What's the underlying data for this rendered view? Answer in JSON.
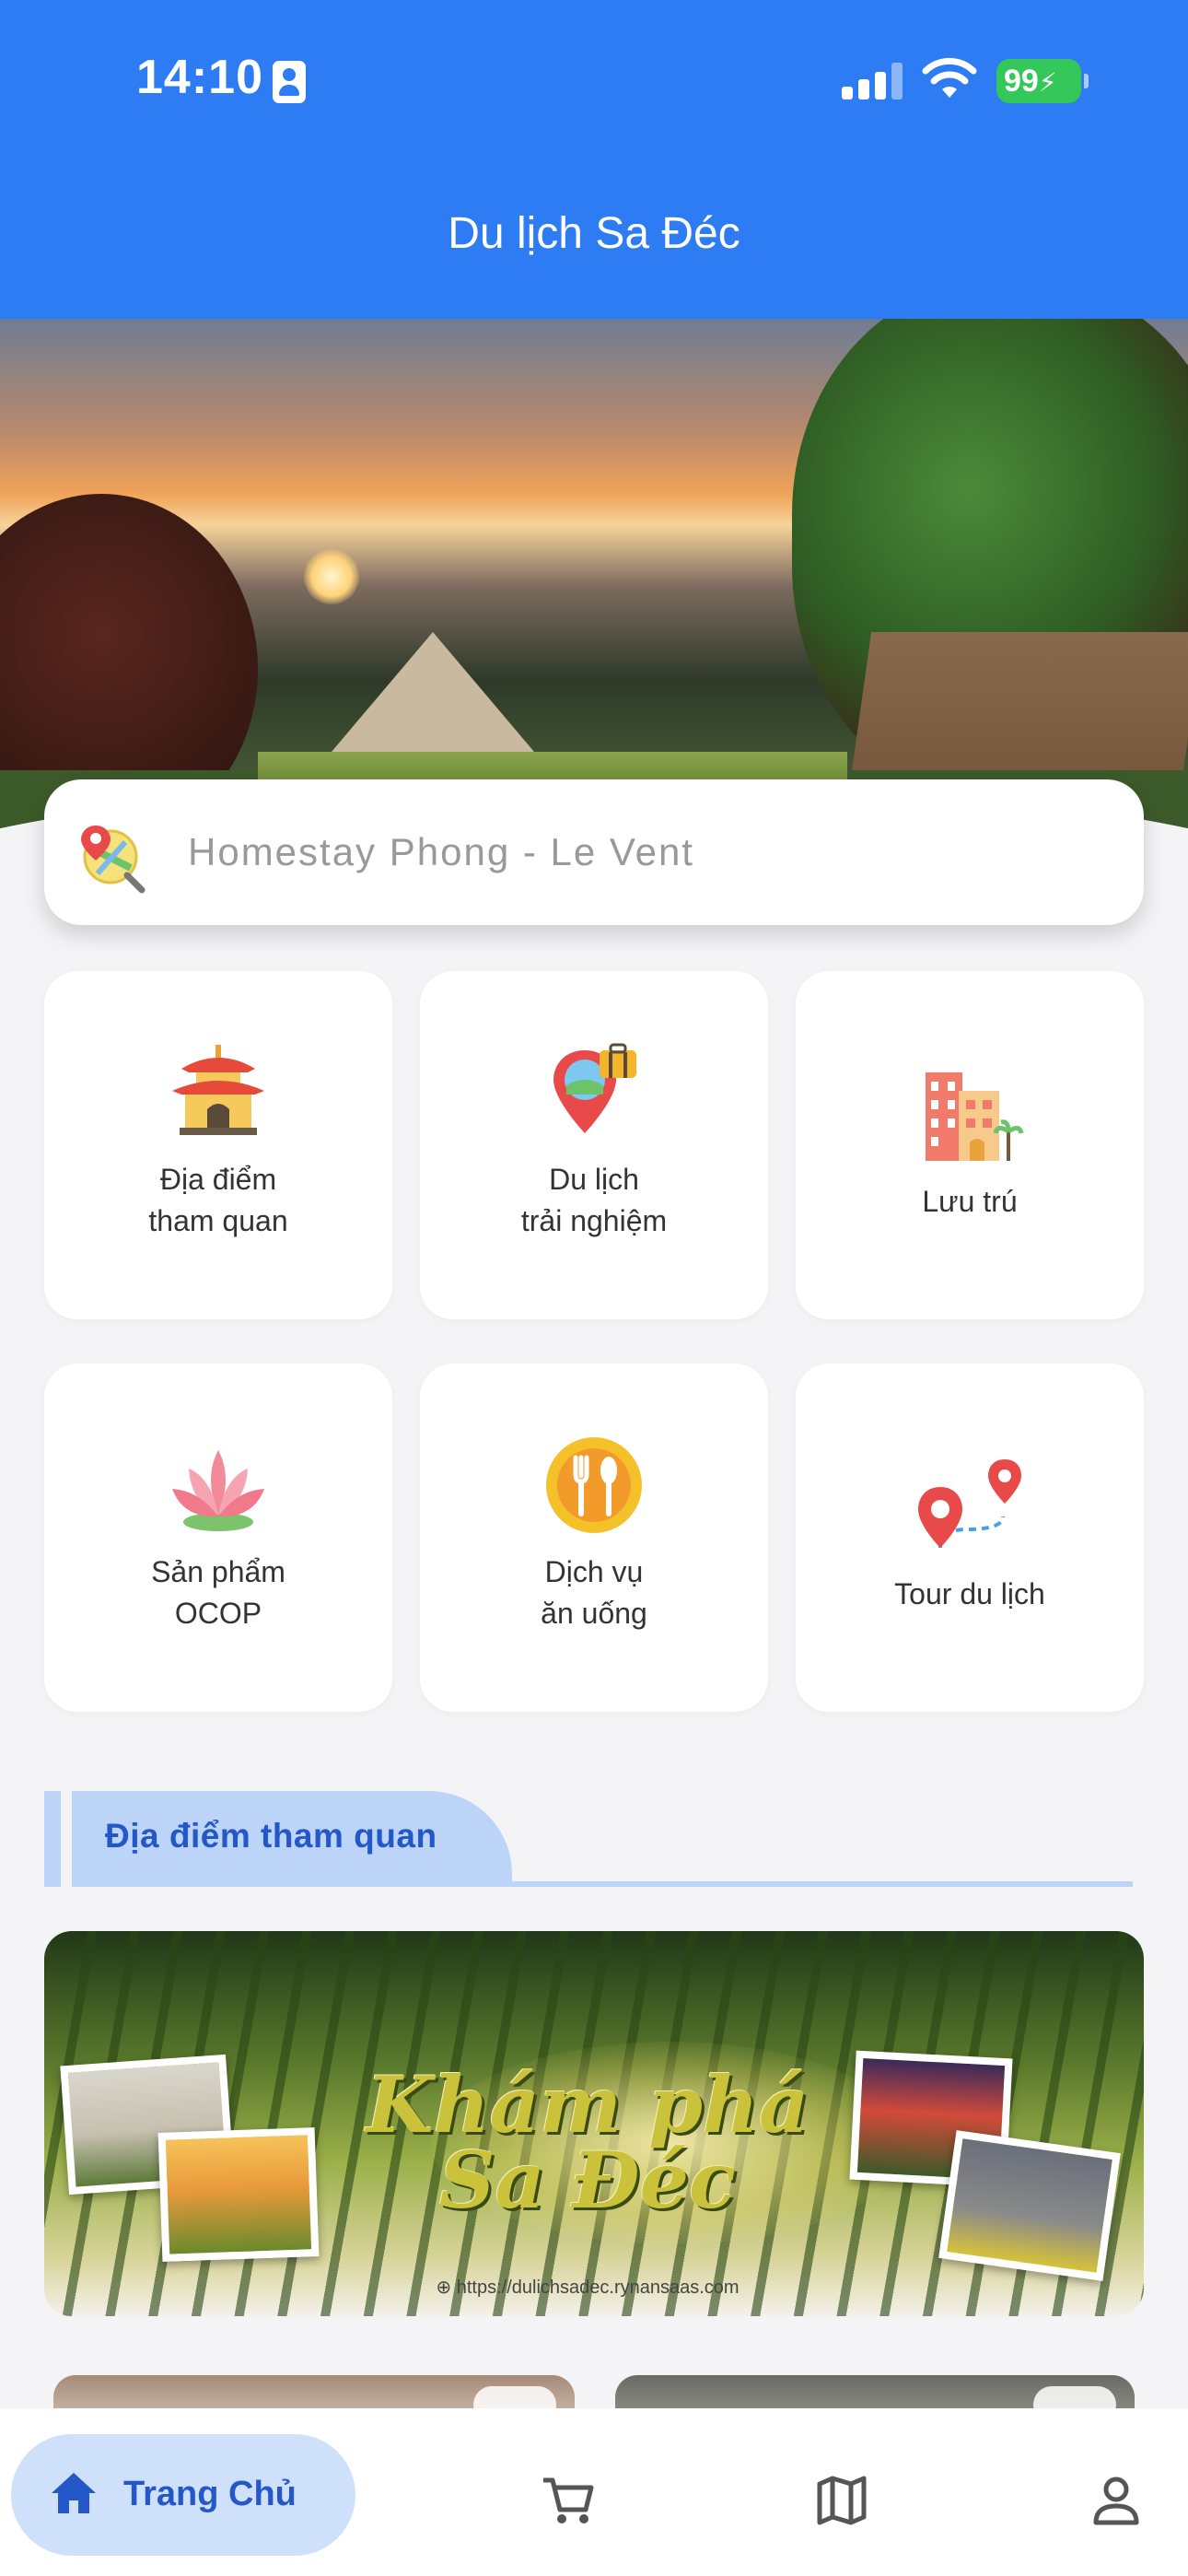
{
  "status_bar": {
    "time": "14:10",
    "battery": "99"
  },
  "app_bar": {
    "title": "Du lịch Sa Đéc"
  },
  "search": {
    "placeholder": "Homestay Phong - Le Vent"
  },
  "categories": [
    {
      "label": "Địa điểm\ntham quan",
      "icon": "pagoda-icon"
    },
    {
      "label": "Du lịch\ntrải nghiệm",
      "icon": "travel-pin-icon"
    },
    {
      "label": "Lưu trú",
      "icon": "hotel-icon"
    },
    {
      "label": "Sản phẩm\nOCOP",
      "icon": "lotus-icon"
    },
    {
      "label": "Dịch vụ\năn uống",
      "icon": "fork-spoon-icon"
    },
    {
      "label": "Tour du lịch",
      "icon": "route-pins-icon"
    }
  ],
  "section": {
    "title": "Địa điểm tham quan"
  },
  "banner": {
    "title_line1": "Khám phá",
    "title_line2": "Sa Đéc",
    "url": "https://dulichsadec.rynansaas.com"
  },
  "bottom_nav": {
    "home_label": "Trang Chủ",
    "items": [
      "home-icon",
      "cart-icon",
      "map-icon",
      "profile-icon"
    ]
  },
  "colors": {
    "primary": "#2d7cf3",
    "accent_text": "#2458c9",
    "section_tint": "#bcd4f8",
    "battery": "#34c759"
  }
}
